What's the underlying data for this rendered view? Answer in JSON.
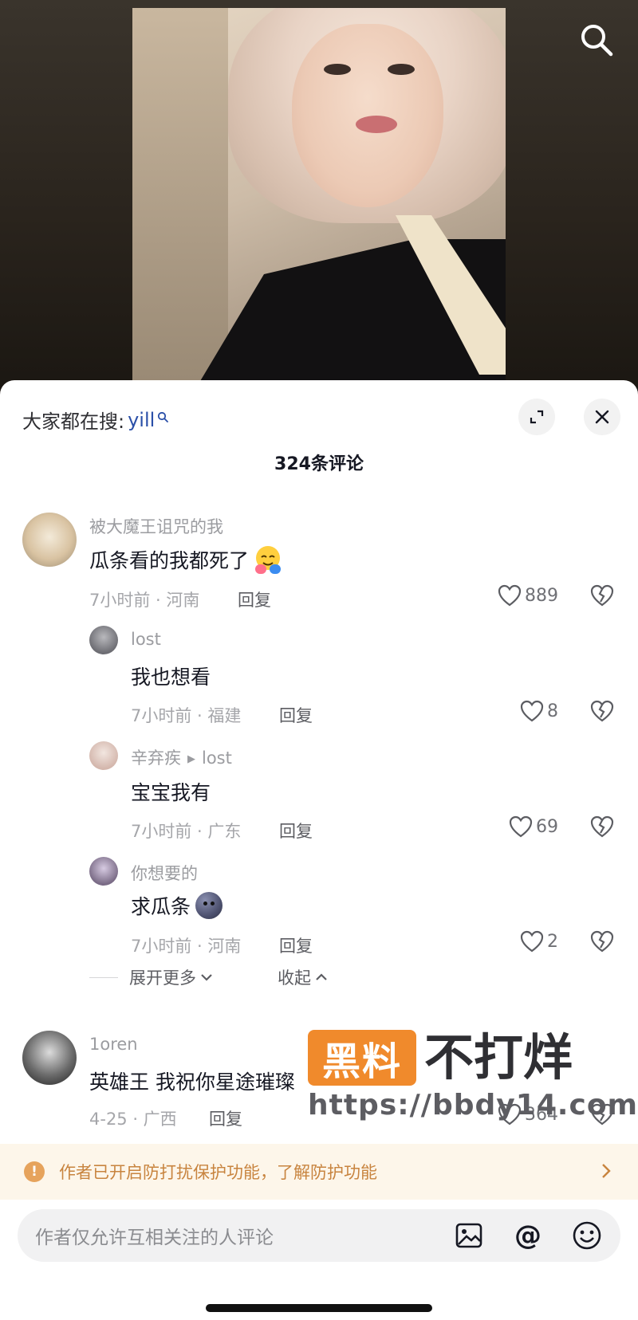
{
  "hot_search": {
    "label": "大家都在搜:",
    "term": "yill"
  },
  "comment_count_title": "324条评论",
  "comments": [
    {
      "user": "被大魔王诅咒的我",
      "text": "瓜条看的我都死了",
      "emoji": "hugging-face",
      "time_location": "7小时前 · 河南",
      "reply_label": "回复",
      "likes": "889"
    },
    {
      "user": "lost",
      "text": "我也想看",
      "time_location": "7小时前 · 福建",
      "reply_label": "回复",
      "likes": "8"
    },
    {
      "user": "辛弃疾",
      "reply_to": "lost",
      "text": "宝宝我有",
      "time_location": "7小时前 · 广东",
      "reply_label": "回复",
      "likes": "69"
    },
    {
      "user": "你想要的",
      "text": "求瓜条",
      "emoji": "round-face",
      "time_location": "7小时前 · 河南",
      "reply_label": "回复",
      "likes": "2"
    },
    {
      "user": "1oren",
      "text": "英雄王 我祝你星途璀璨",
      "time_location": "4-25 · 广西",
      "reply_label": "回复",
      "likes": "364"
    }
  ],
  "expand_more_label": "展开更多",
  "collapse_label": "收起",
  "watermark": {
    "box_text": "黑料",
    "brand": "不打烊",
    "url": "https://bbdy14.com"
  },
  "protection_notice": "作者已开启防打扰保护功能，了解防护功能",
  "input_placeholder": "作者仅允许互相关注的人评论",
  "colors": {
    "accent_link": "#2a4fa8",
    "notice_text": "#c8843f",
    "notice_bg": "#fdf6ea",
    "watermark_orange": "#f08a2c"
  }
}
